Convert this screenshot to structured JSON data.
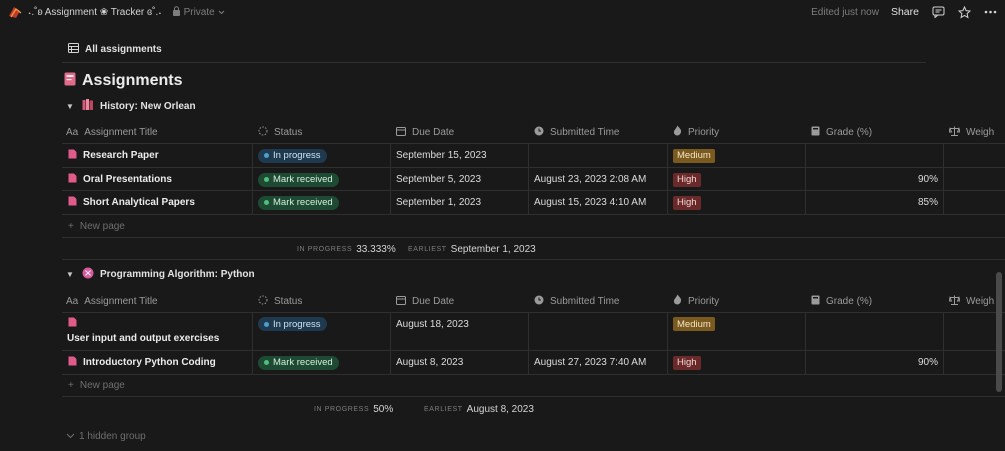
{
  "topbar": {
    "breadcrumb": "˖.˚ʚ Assignment ❀ Tracker ɞ˚.˖",
    "privacy": "Private",
    "edited": "Edited just now",
    "share": "Share"
  },
  "view": {
    "tab_label": "All assignments"
  },
  "database": {
    "title": "Assignments"
  },
  "columns": {
    "title": "Assignment Title",
    "status": "Status",
    "due": "Due Date",
    "submitted": "Submitted Time",
    "priority": "Priority",
    "grade": "Grade (%)",
    "weight": "Weigh"
  },
  "groups": [
    {
      "name": "History: New Orlean",
      "rows": [
        {
          "title": "Research Paper",
          "status": "In progress",
          "due": "September 15, 2023",
          "submitted": "",
          "priority": "Medium",
          "grade": ""
        },
        {
          "title": "Oral Presentations",
          "status": "Mark received",
          "due": "September 5, 2023",
          "submitted": "August 23, 2023 2:08 AM",
          "priority": "High",
          "grade": "90%"
        },
        {
          "title": "Short Analytical Papers",
          "status": "Mark received",
          "due": "September 1, 2023",
          "submitted": "August 15, 2023 4:10 AM",
          "priority": "High",
          "grade": "85%"
        }
      ],
      "new_page": "New page",
      "summary": {
        "in_progress_label": "IN PROGRESS",
        "in_progress_value": "33.333%",
        "earliest_label": "EARLIEST",
        "earliest_value": "September 1, 2023"
      }
    },
    {
      "name": "Programming Algorithm: Python",
      "rows": [
        {
          "title": "User input and output exercises",
          "status": "In progress",
          "due": "August 18, 2023",
          "submitted": "",
          "priority": "Medium",
          "grade": ""
        },
        {
          "title": "Introductory Python Coding",
          "status": "Mark received",
          "due": "August 8, 2023",
          "submitted": "August 27, 2023 7:40 AM",
          "priority": "High",
          "grade": "90%"
        }
      ],
      "new_page": "New page",
      "summary": {
        "in_progress_label": "IN PROGRESS",
        "in_progress_value": "50%",
        "earliest_label": "EARLIEST",
        "earliest_value": "August 8, 2023"
      }
    }
  ],
  "hidden_group": "1 hidden group",
  "colors": {
    "background": "#191919",
    "in_progress": "#1f3a4f",
    "mark_received": "#1e4a33",
    "medium": "#7a5a1e",
    "high": "#6b2a2a"
  }
}
